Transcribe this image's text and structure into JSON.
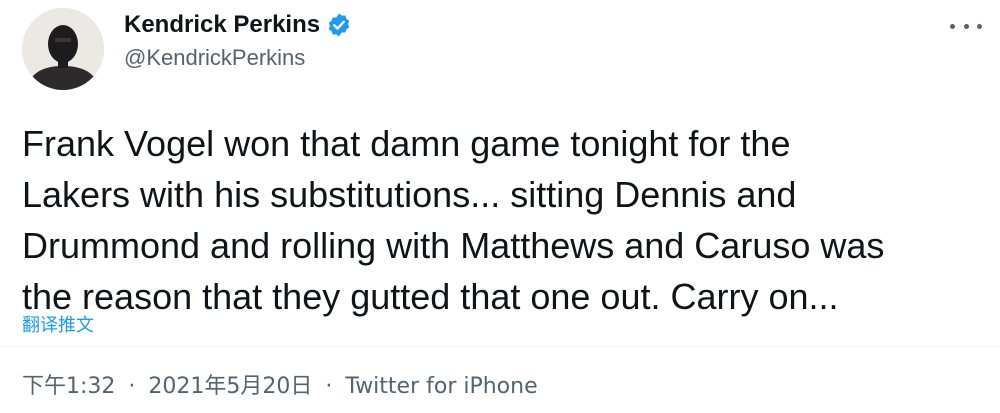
{
  "author": {
    "display_name": "Kendrick Perkins",
    "handle": "@KendrickPerkins",
    "verified_icon": "verified-badge-icon",
    "avatar_icon": "profile-avatar"
  },
  "more_icon": "more-horizontal-icon",
  "tweet": {
    "text": "Frank Vogel won that damn game tonight for the\nLakers with his substitutions... sitting Dennis and\nDrummond and rolling with Matthews and Caruso was\nthe reason that they gutted that one out. Carry on...",
    "translate_label": "翻译推文"
  },
  "meta": {
    "time": "下午1:32",
    "separator": "·",
    "date": "2021年5月20日",
    "source": "Twitter for iPhone"
  },
  "colors": {
    "accent": "#1d9bf0",
    "text": "#0f1419",
    "secondary": "#536471"
  }
}
